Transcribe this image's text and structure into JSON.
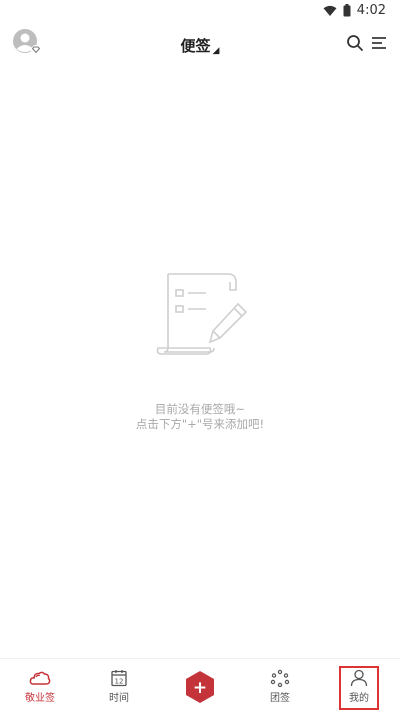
{
  "status_bar": {
    "time": "4:02"
  },
  "header": {
    "title": "便签",
    "title_suffix": "◢"
  },
  "empty_state": {
    "line1": "目前没有便签哦~",
    "line2": "点击下方\"+\"号来添加吧!"
  },
  "bottom_nav": {
    "items": [
      {
        "label": "敬业签",
        "icon": "cloud-icon",
        "active": true
      },
      {
        "label": "时间",
        "icon": "calendar-icon",
        "active": false
      },
      {
        "label": "+",
        "icon": "add-icon",
        "active": false
      },
      {
        "label": "团签",
        "icon": "group-icon",
        "active": false
      },
      {
        "label": "我的",
        "icon": "user-icon",
        "active": false
      }
    ]
  },
  "colors": {
    "accent": "#c5333a",
    "highlight": "#dd3333",
    "muted": "#a9a9a9"
  }
}
